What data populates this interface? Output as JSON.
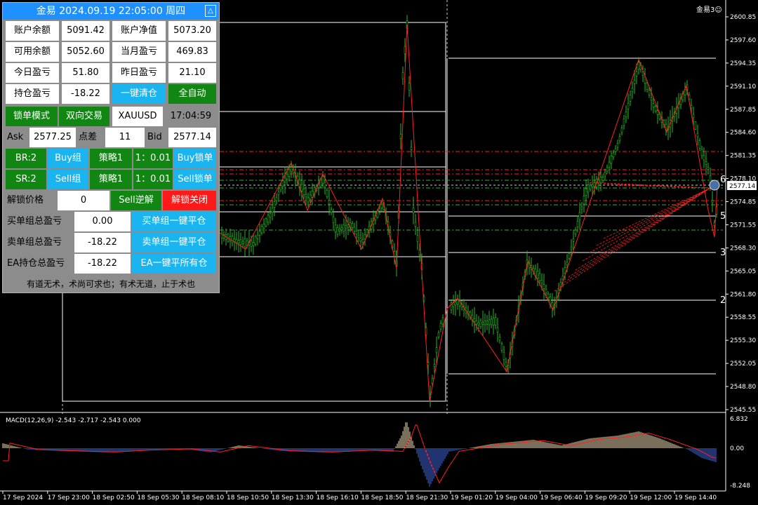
{
  "panel": {
    "title": "金易 2024.09.19 22:05:00 周四",
    "collapse_glyph": "△",
    "balance_label": "账户余额",
    "balance_value": "5091.42",
    "equity_label": "账户净值",
    "equity_value": "5073.20",
    "free_label": "可用余额",
    "free_value": "5052.60",
    "month_label": "当月盈亏",
    "month_value": "469.83",
    "today_label": "今日盈亏",
    "today_value": "51.80",
    "yday_label": "昨日盈亏",
    "yday_value": "21.10",
    "pos_label": "持仓盈亏",
    "pos_value": "-18.22",
    "close_all": "一键清仓",
    "auto": "全自动",
    "lock_mode": "锁单模式",
    "two_way": "双向交易",
    "symbol": "XAUUSD",
    "time": "17:04:59",
    "ask_label": "Ask",
    "ask_value": "2577.25",
    "spread_label": "点差",
    "spread_value": "11",
    "bid_label": "Bid",
    "bid_value": "2577.14",
    "br": "BR:2",
    "buy_group": "Buy组",
    "strategy1": "策略1",
    "ratio1": "1：0.01",
    "buy_lock": "Buy锁单",
    "sr": "SR:2",
    "sell_group": "Sell组",
    "strategy2": "策略1",
    "ratio2": "1：0.01",
    "sell_lock": "Sell锁单",
    "unlock_price_label": "解锁价格",
    "unlock_price_value": "0",
    "sell_reverse": "Sell逆解",
    "unlock_close": "解锁关闭",
    "buy_total_label": "买单组总盈亏",
    "buy_total_value": "0.00",
    "buy_close": "买单组一键平仓",
    "sell_total_label": "卖单组总盈亏",
    "sell_total_value": "-18.22",
    "sell_close": "卖单组一键平仓",
    "ea_total_label": "EA持仓总盈亏",
    "ea_total_value": "-18.22",
    "ea_close": "EA一键平所有仓",
    "motto": "有道无术，术尚可求也；有术无道，止于术也"
  },
  "watermark": "金易3☺",
  "chart_data": {
    "type": "candlestick",
    "symbol": "XAUUSD",
    "current_price": "2577.14",
    "price_axis_labels": [
      "2600.85",
      "2597.60",
      "2594.35",
      "2591.10",
      "2587.85",
      "2584.60",
      "2581.35",
      "2578.10",
      "2574.85",
      "2571.55",
      "2568.30",
      "2565.05",
      "2561.80",
      "2558.55",
      "2555.30",
      "2552.05",
      "2548.80",
      "2545.55"
    ],
    "ylim": [
      2545.55,
      2600.85
    ],
    "right_edge_labels": [
      "6",
      "5",
      "3",
      "2"
    ],
    "time_axis_labels": [
      "17 Sep 2024",
      "17 Sep 23:00",
      "18 Sep 02:50",
      "18 Sep 05:30",
      "18 Sep 08:10",
      "18 Sep 10:50",
      "18 Sep 13:30",
      "18 Sep 16:10",
      "18 Sep 18:50",
      "18 Sep 21:30",
      "19 Sep 01:20",
      "19 Sep 04:00",
      "19 Sep 06:40",
      "19 Sep 09:20",
      "19 Sep 12:00",
      "19 Sep 14:40"
    ],
    "indicator": {
      "label": "MACD(12,26,9) -2.543 -2.717 -2.543 0.000",
      "axis_labels": [
        "6.832",
        "0.00",
        "-8.248"
      ]
    },
    "colors": {
      "bull": "#2db52d",
      "bear": "#2db52d",
      "zigzag": "#ff2020",
      "histogram_pos": "#f5deb3",
      "histogram_neg": "#4169e1",
      "signal": "#ff2020"
    }
  }
}
